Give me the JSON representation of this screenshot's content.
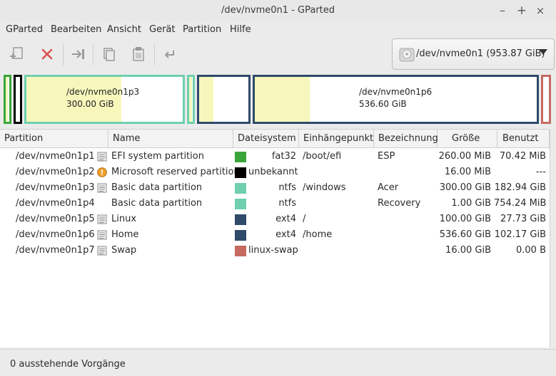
{
  "window": {
    "title": "/dev/nvme0n1 - GParted"
  },
  "window_controls": {
    "minimize": "–",
    "maximize": "+",
    "close": "×"
  },
  "menubar": [
    "GParted",
    "Bearbeiten",
    "Ansicht",
    "Gerät",
    "Partition",
    "Hilfe"
  ],
  "toolbar": {
    "buttons": [
      "new-partition",
      "delete-partition",
      "resize-move",
      "copy",
      "paste",
      "undo"
    ]
  },
  "device_selector": {
    "label": "/dev/nvme0n1  (953.87 GiB)"
  },
  "diskmap": {
    "p3": {
      "name": "/dev/nvme0n1p3",
      "size": "300.00 GiB"
    },
    "p6": {
      "name": "/dev/nvme0n1p6",
      "size": "536.60 GiB"
    }
  },
  "table": {
    "headers": [
      "Partition",
      "Name",
      "Dateisystem",
      "Einhängepunkt",
      "Bezeichnung",
      "Größe",
      "Benutzt"
    ],
    "rows": [
      {
        "partition": "/dev/nvme0n1p1",
        "name": "EFI system partition",
        "fs": "fat32",
        "fs_color": "#3aa63a",
        "mount": "/boot/efi",
        "label": "ESP",
        "size": "260.00 MiB",
        "used": "70.42 MiB",
        "icon": "info-icon"
      },
      {
        "partition": "/dev/nvme0n1p2",
        "name": "Microsoft reserved partition",
        "fs": "unbekannt",
        "fs_color": "#000000",
        "mount": "",
        "label": "",
        "size": "16.00 MiB",
        "used": "---",
        "icon": "warning-icon"
      },
      {
        "partition": "/dev/nvme0n1p3",
        "name": "Basic data partition",
        "fs": "ntfs",
        "fs_color": "#6fcfaf",
        "mount": "/windows",
        "label": "Acer",
        "size": "300.00 GiB",
        "used": "182.94 GiB",
        "icon": "info-icon"
      },
      {
        "partition": "/dev/nvme0n1p4",
        "name": "Basic data partition",
        "fs": "ntfs",
        "fs_color": "#6fcfaf",
        "mount": "",
        "label": "Recovery",
        "size": "1.00 GiB",
        "used": "754.24 MiB",
        "icon": ""
      },
      {
        "partition": "/dev/nvme0n1p5",
        "name": "Linux",
        "fs": "ext4",
        "fs_color": "#2f4a6a",
        "mount": "/",
        "label": "",
        "size": "100.00 GiB",
        "used": "27.73 GiB",
        "icon": "info-icon"
      },
      {
        "partition": "/dev/nvme0n1p6",
        "name": "Home",
        "fs": "ext4",
        "fs_color": "#2f4a6a",
        "mount": "/home",
        "label": "",
        "size": "536.60 GiB",
        "used": "102.17 GiB",
        "icon": "info-icon"
      },
      {
        "partition": "/dev/nvme0n1p7",
        "name": "Swap",
        "fs": "linux-swap",
        "fs_color": "#c66a62",
        "mount": "",
        "label": "",
        "size": "16.00 GiB",
        "used": "0.00 B",
        "icon": "info-icon"
      }
    ]
  },
  "statusbar": {
    "text": "0 ausstehende Vorgänge"
  }
}
